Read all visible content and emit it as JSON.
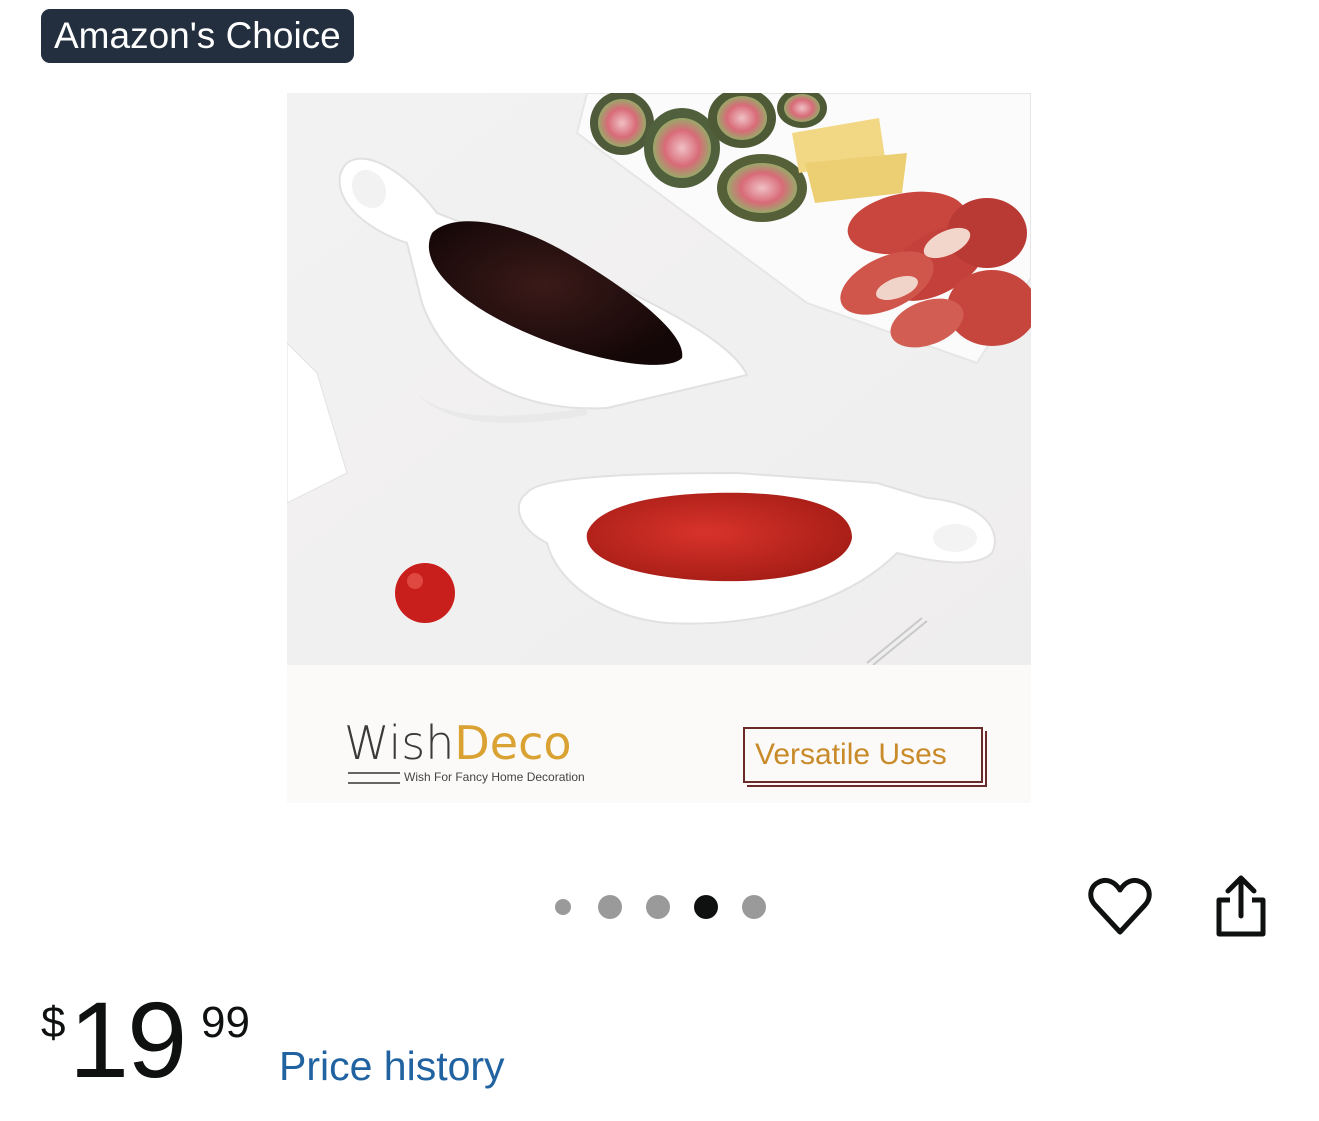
{
  "badge": {
    "label": "Amazon's Choice"
  },
  "product_image": {
    "brand_name_part1": "Wish",
    "brand_name_part2": "Deco",
    "brand_tagline": "Wish For Fancy Home Decoration",
    "feature_label": "Versatile Uses"
  },
  "carousel": {
    "dot_count": 5,
    "active_index": 3
  },
  "actions": {
    "wishlist_icon": "heart-icon",
    "share_icon": "share-icon"
  },
  "price": {
    "symbol": "$",
    "whole": "19",
    "fraction": "99",
    "history_link": "Price history"
  },
  "colors": {
    "badge_bg": "#232f3e",
    "link": "#2162a1",
    "brand_accent": "#d9a233",
    "dot_active": "#0f1111",
    "dot_inactive": "#9a9a9a"
  }
}
